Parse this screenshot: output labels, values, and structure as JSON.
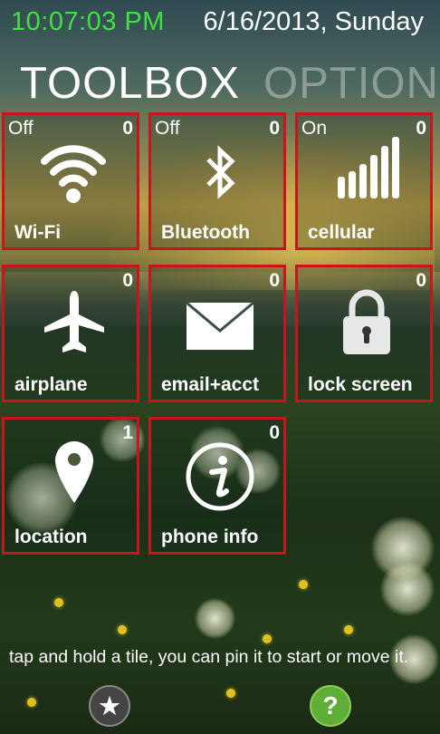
{
  "status": {
    "time": "10:07:03 PM",
    "date": "6/16/2013, Sunday"
  },
  "pivot": {
    "active": "TOOLBOX",
    "inactive": "OPTIONS"
  },
  "tiles": [
    {
      "label": "Wi-Fi",
      "state": "Off",
      "count": "0",
      "icon": "wifi-icon"
    },
    {
      "label": "Bluetooth",
      "state": "Off",
      "count": "0",
      "icon": "bluetooth-icon"
    },
    {
      "label": "cellular",
      "state": "On",
      "count": "0",
      "icon": "signal-bars-icon"
    },
    {
      "label": "airplane",
      "state": "",
      "count": "0",
      "icon": "airplane-icon"
    },
    {
      "label": "email+acct",
      "state": "",
      "count": "0",
      "icon": "envelope-icon"
    },
    {
      "label": "lock screen",
      "state": "",
      "count": "0",
      "icon": "padlock-icon"
    },
    {
      "label": "location",
      "state": "",
      "count": "1",
      "icon": "map-pin-icon"
    },
    {
      "label": "phone info",
      "state": "",
      "count": "0",
      "icon": "info-icon"
    }
  ],
  "hint": "tap and hold a tile, you can pin it to start or move it.",
  "appbar": {
    "favorite_icon": "star-icon",
    "favorite_glyph": "★",
    "help_icon": "question-icon",
    "help_glyph": "?"
  },
  "colors": {
    "clock": "#3fe23f",
    "tile_border": "#c4161c"
  }
}
